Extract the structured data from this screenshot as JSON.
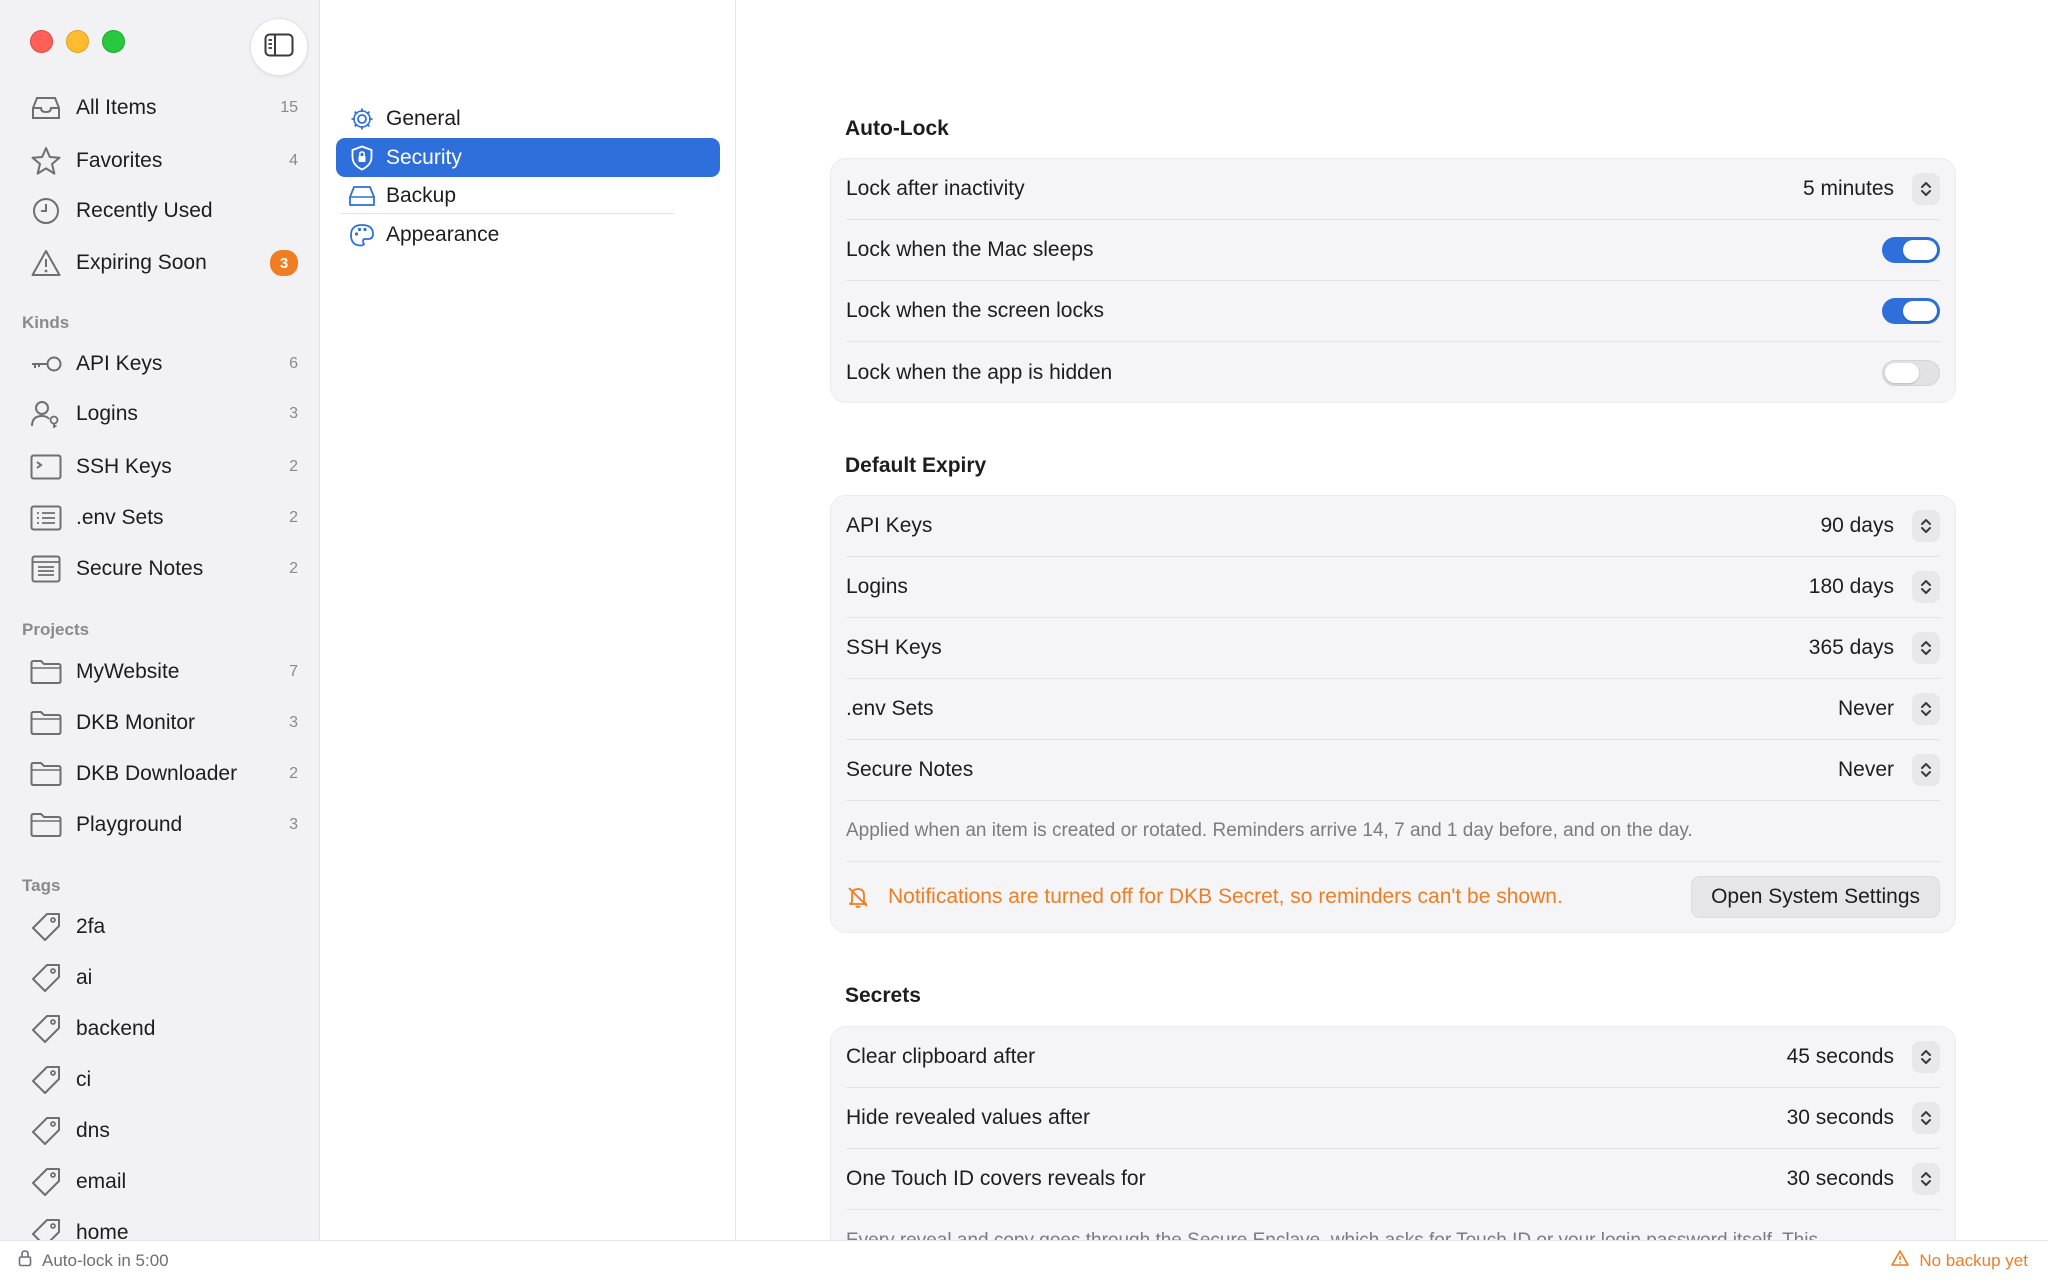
{
  "sidebar": {
    "toggle_icon": "sidebar-toggle-icon",
    "library": [
      {
        "label": "All Items",
        "count": "15",
        "icon": "tray-icon"
      },
      {
        "label": "Favorites",
        "count": "4",
        "icon": "star-icon"
      },
      {
        "label": "Recently Used",
        "count": "",
        "icon": "clock-icon"
      },
      {
        "label": "Expiring Soon",
        "badge": "3",
        "icon": "warning-icon"
      }
    ],
    "kinds_title": "Kinds",
    "kinds": [
      {
        "label": "API Keys",
        "count": "6",
        "icon": "key-icon"
      },
      {
        "label": "Logins",
        "count": "3",
        "icon": "person-key-icon"
      },
      {
        "label": "SSH Keys",
        "count": "2",
        "icon": "terminal-icon"
      },
      {
        "label": ".env Sets",
        "count": "2",
        "icon": "list-icon"
      },
      {
        "label": "Secure Notes",
        "count": "2",
        "icon": "note-icon"
      }
    ],
    "projects_title": "Projects",
    "projects": [
      {
        "label": "MyWebsite",
        "count": "7",
        "icon": "folder-icon"
      },
      {
        "label": "DKB Monitor",
        "count": "3",
        "icon": "folder-icon"
      },
      {
        "label": "DKB Downloader",
        "count": "2",
        "icon": "folder-icon"
      },
      {
        "label": "Playground",
        "count": "3",
        "icon": "folder-icon"
      }
    ],
    "tags_title": "Tags",
    "tags": [
      {
        "label": "2fa"
      },
      {
        "label": "ai"
      },
      {
        "label": "backend"
      },
      {
        "label": "ci"
      },
      {
        "label": "dns"
      },
      {
        "label": "email"
      },
      {
        "label": "home"
      }
    ]
  },
  "categories": [
    {
      "label": "General",
      "icon": "gear-icon"
    },
    {
      "label": "Security",
      "icon": "shield-icon",
      "selected": true
    },
    {
      "label": "Backup",
      "icon": "drive-icon"
    },
    {
      "label": "Appearance",
      "icon": "palette-icon"
    }
  ],
  "main": {
    "autolock": {
      "title": "Auto-Lock",
      "lock_after_label": "Lock after inactivity",
      "lock_after_value": "5 minutes",
      "mac_sleeps_label": "Lock when the Mac sleeps",
      "mac_sleeps_on": true,
      "screen_locks_label": "Lock when the screen locks",
      "screen_locks_on": true,
      "app_hidden_label": "Lock when the app is hidden",
      "app_hidden_on": false
    },
    "expiry": {
      "title": "Default Expiry",
      "rows": [
        {
          "label": "API Keys",
          "value": "90 days"
        },
        {
          "label": "Logins",
          "value": "180 days"
        },
        {
          "label": "SSH Keys",
          "value": "365 days"
        },
        {
          "label": ".env Sets",
          "value": "Never"
        },
        {
          "label": "Secure Notes",
          "value": "Never"
        }
      ],
      "note": "Applied when an item is created or rotated. Reminders arrive 14, 7 and 1 day before, and on the day.",
      "warning": "Notifications are turned off for DKB Secret, so reminders can't be shown.",
      "warning_icon": "bell-slash-icon",
      "button": "Open System Settings"
    },
    "secrets": {
      "title": "Secrets",
      "rows": [
        {
          "label": "Clear clipboard after",
          "value": "45 seconds"
        },
        {
          "label": "Hide revealed values after",
          "value": "30 seconds"
        },
        {
          "label": "One Touch ID covers reveals for",
          "value": "30 seconds"
        }
      ],
      "note": "Every reveal and copy goes through the Secure Enclave, which asks for Touch ID or your login password itself. This"
    }
  },
  "status": {
    "left": "Auto-lock in 5:00",
    "left_icon": "lock-icon",
    "right": "No backup yet",
    "right_icon": "warning-icon"
  },
  "colors": {
    "accent": "#2e6fdc",
    "warning": "#ef7d22",
    "sidebar_bg": "#f2f2f4",
    "group_bg": "#f5f5f7"
  }
}
